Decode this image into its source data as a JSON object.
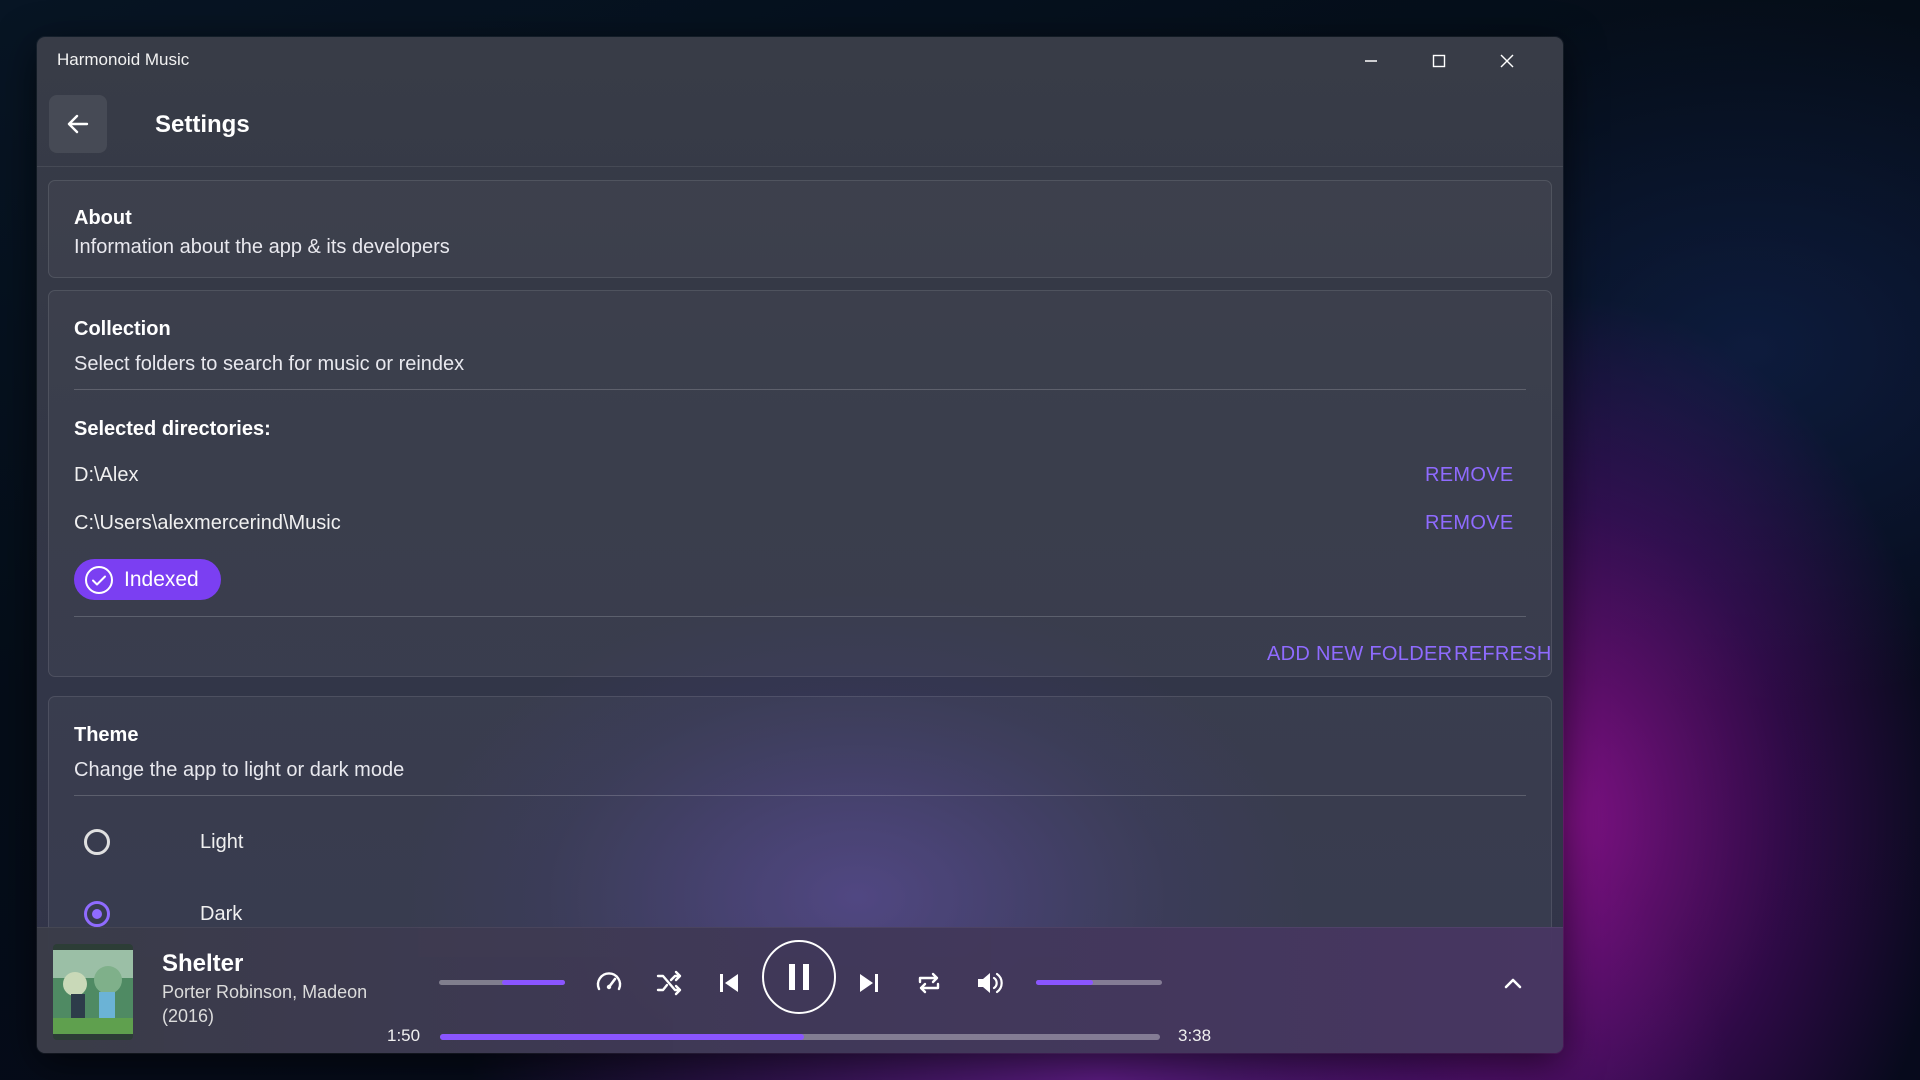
{
  "window": {
    "title": "Harmonoid Music"
  },
  "header": {
    "title": "Settings"
  },
  "about": {
    "title": "About",
    "subtitle": "Information about the app & its developers"
  },
  "collection": {
    "title": "Collection",
    "subtitle": "Select folders to search for music or reindex",
    "selected_label": "Selected directories:",
    "directories": [
      {
        "path": "D:\\Alex",
        "action": "REMOVE"
      },
      {
        "path": "C:\\Users\\alexmercerind\\Music",
        "action": "REMOVE"
      }
    ],
    "status_chip": "Indexed",
    "add_folder": "ADD NEW FOLDER",
    "refresh": "REFRESH"
  },
  "theme": {
    "title": "Theme",
    "subtitle": "Change the app to light or dark mode",
    "options": [
      {
        "label": "Light",
        "selected": false
      },
      {
        "label": "Dark",
        "selected": true
      }
    ]
  },
  "player": {
    "title": "Shelter",
    "artist": "Porter Robinson, Madeon",
    "year": "(2016)",
    "current_time": "1:50",
    "total_time": "3:38",
    "progress": 0.505,
    "speed_level": 0.5,
    "volume_level": 0.45,
    "is_playing": true
  },
  "colors": {
    "accent": "#8a55ff",
    "link": "#8f6bff",
    "chip": "#7b3ff2"
  }
}
